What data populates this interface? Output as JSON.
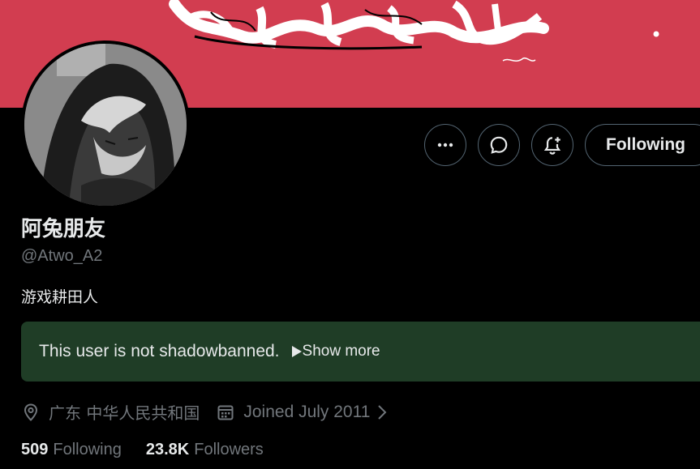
{
  "profile": {
    "display_name": "阿兔朋友",
    "handle": "@Atwo_A2",
    "bio": "游戏耕田人",
    "location": "广东 中华人民共和国",
    "joined": "Joined July 2011"
  },
  "actions": {
    "more_icon": "more-horizontal-icon",
    "message_icon": "message-icon",
    "notify_icon": "bell-plus-icon",
    "following_label": "Following"
  },
  "shadowban": {
    "text": "This user is not shadowbanned.",
    "show_more": "Show more"
  },
  "stats": {
    "following_count": "509",
    "following_label": "Following",
    "followers_count": "23.8K",
    "followers_label": "Followers"
  },
  "colors": {
    "banner": "#d23d50",
    "shadow_box": "#1f3d26",
    "muted": "#71767b"
  }
}
